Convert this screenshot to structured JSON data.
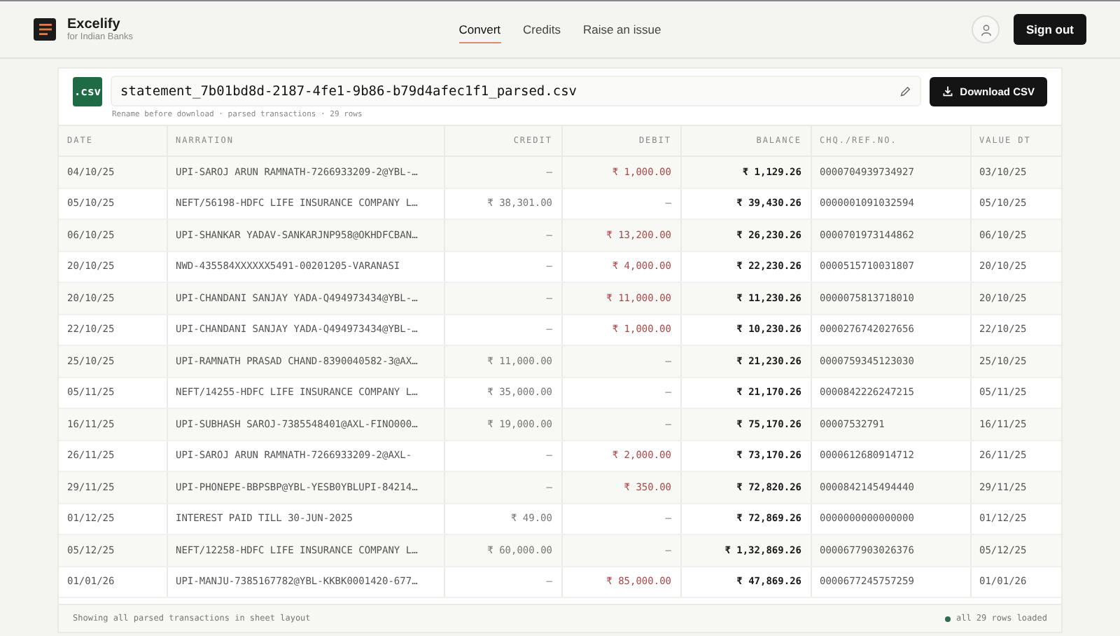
{
  "app": {
    "name": "Excelify",
    "tagline": "for Indian Banks"
  },
  "nav": [
    {
      "label": "Convert",
      "selected": true
    },
    {
      "label": "Credits",
      "selected": false
    },
    {
      "label": "Raise an issue",
      "selected": false
    }
  ],
  "sign_out": "Sign out",
  "file": {
    "badge": ".csv",
    "filename": "statement_7b01bd8d-2187-4fe1-9b86-b79d4afec1f1_parsed.csv",
    "hint": "Rename before download · parsed transactions · 29 rows",
    "download": "Download CSV"
  },
  "table": {
    "columns": [
      "DATE",
      "NARRATION",
      "CREDIT",
      "DEBIT",
      "BALANCE",
      "CHQ./REF.NO.",
      "VALUE DT"
    ],
    "rows": [
      [
        "04/10/25",
        "UPI-SAROJ ARUN RAMNATH-7266933209-2@YBL-…",
        "—",
        "₹ 1,000.00",
        "₹ 1,129.26",
        "0000704939734927",
        "03/10/25"
      ],
      [
        "05/10/25",
        "NEFT/56198-HDFC LIFE INSURANCE COMPANY L…",
        "₹ 38,301.00",
        "—",
        "₹ 39,430.26",
        "0000001091032594",
        "05/10/25"
      ],
      [
        "06/10/25",
        "UPI-SHANKAR YADAV-SANKARJNP958@OKHDFCBAN…",
        "—",
        "₹ 13,200.00",
        "₹ 26,230.26",
        "0000701973144862",
        "06/10/25"
      ],
      [
        "20/10/25",
        "NWD-435584XXXXXX5491-00201205-VARANASI",
        "—",
        "₹ 4,000.00",
        "₹ 22,230.26",
        "0000515710031807",
        "20/10/25"
      ],
      [
        "20/10/25",
        "UPI-CHANDANI SANJAY YADA-Q494973434@YBL-…",
        "—",
        "₹ 11,000.00",
        "₹ 11,230.26",
        "0000075813718010",
        "20/10/25"
      ],
      [
        "22/10/25",
        "UPI-CHANDANI SANJAY YADA-Q494973434@YBL-…",
        "—",
        "₹ 1,000.00",
        "₹ 10,230.26",
        "0000276742027656",
        "22/10/25"
      ],
      [
        "25/10/25",
        "UPI-RAMNATH PRASAD CHAND-8390040582-3@AX…",
        "₹ 11,000.00",
        "—",
        "₹ 21,230.26",
        "0000759345123030",
        "25/10/25"
      ],
      [
        "05/11/25",
        "NEFT/14255-HDFC LIFE INSURANCE COMPANY L…",
        "₹ 35,000.00",
        "—",
        "₹ 21,170.26",
        "0000842226247215",
        "05/11/25"
      ],
      [
        "16/11/25",
        "UPI-SUBHASH SAROJ-7385548401@AXL-FINO000…",
        "₹ 19,000.00",
        "—",
        "₹ 75,170.26",
        "00007532791",
        "16/11/25"
      ],
      [
        "26/11/25",
        "UPI-SAROJ ARUN RAMNATH-7266933209-2@AXL-",
        "—",
        "₹ 2,000.00",
        "₹ 73,170.26",
        "0000612680914712",
        "26/11/25"
      ],
      [
        "29/11/25",
        "UPI-PHONEPE-BBPSBP@YBL-YESB0YBLUPI-84214…",
        "—",
        "₹ 350.00",
        "₹ 72,820.26",
        "0000842145494440",
        "29/11/25"
      ],
      [
        "01/12/25",
        "INTEREST PAID TILL 30-JUN-2025",
        "₹ 49.00",
        "—",
        "₹ 72,869.26",
        "0000000000000000",
        "01/12/25"
      ],
      [
        "05/12/25",
        "NEFT/12258-HDFC LIFE INSURANCE COMPANY L…",
        "₹ 60,000.00",
        "—",
        "₹ 1,32,869.26",
        "0000677903026376",
        "05/12/25"
      ],
      [
        "01/01/26",
        "UPI-MANJU-7385167782@YBL-KKBK0001420-677…",
        "—",
        "₹ 85,000.00",
        "₹ 47,869.26",
        "0000677245757259",
        "01/01/26"
      ]
    ]
  },
  "footer": {
    "note": "Showing all parsed transactions in sheet layout",
    "status": "all 29 rows loaded"
  }
}
